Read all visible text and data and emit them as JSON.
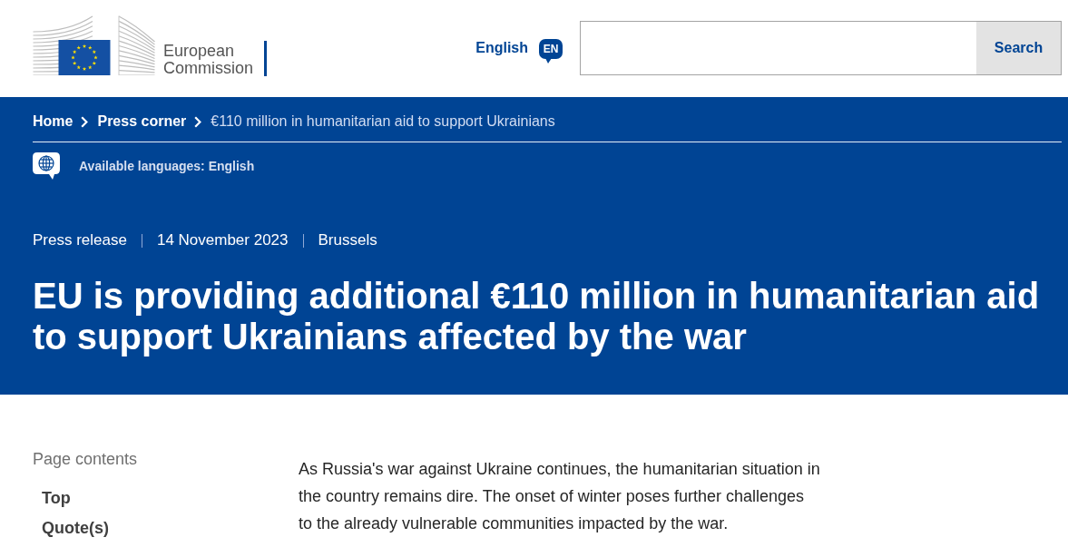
{
  "header": {
    "logo_text": "European Commission",
    "language": {
      "label": "English",
      "code": "EN"
    },
    "search": {
      "button": "Search"
    }
  },
  "breadcrumb": [
    {
      "label": "Home",
      "kind": "link"
    },
    {
      "label": "Press corner",
      "kind": "link"
    },
    {
      "label": "€110 million in humanitarian aid to support Ukrainians",
      "kind": "current"
    }
  ],
  "available_languages": "Available languages: English",
  "meta": [
    "Press release",
    "14 November 2023",
    "Brussels"
  ],
  "title": "EU is providing additional €110 million in humanitarian aid to support Ukrainians affected by the war",
  "page_contents": {
    "heading": "Page contents",
    "items": [
      "Top",
      "Quote(s)"
    ]
  },
  "body": [
    "As Russia's war against Ukraine continues, the humanitarian situation in the country remains dire. The onset of winter poses further challenges to the already vulnerable communities impacted by the war."
  ]
}
